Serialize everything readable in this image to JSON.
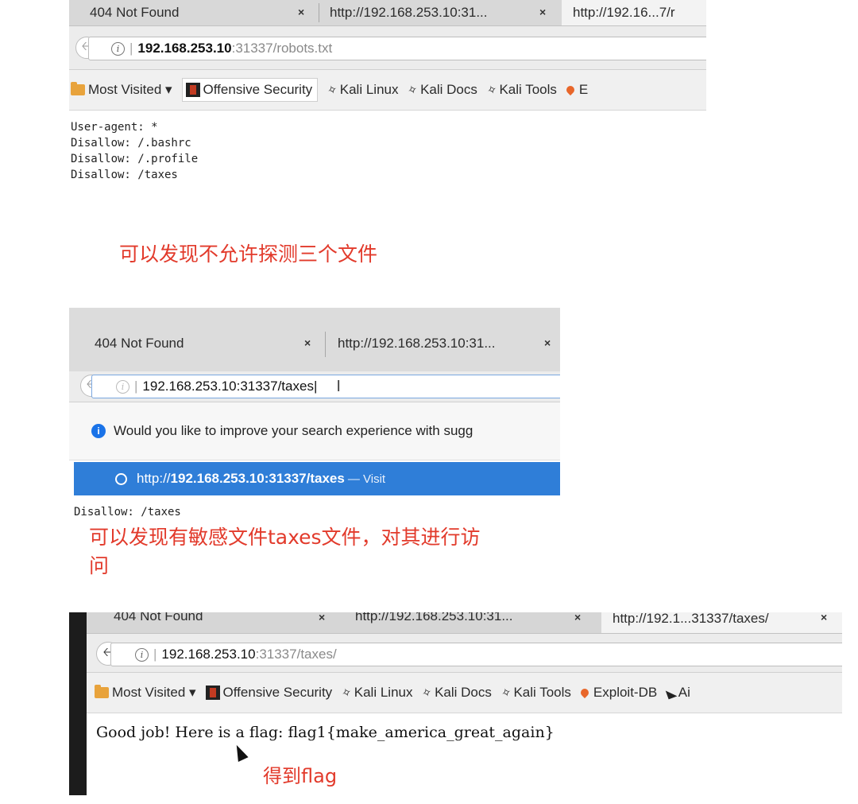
{
  "shot1": {
    "tabs": [
      {
        "label": "404 Not Found",
        "close": "×"
      },
      {
        "label": "http://192.168.253.10:31...",
        "close": "×"
      },
      {
        "label": "http://192.16...7/r"
      }
    ],
    "url_host": "192.168.253.10",
    "url_path": ":31337/robots.txt",
    "bookmarks": {
      "most_visited": "Most Visited ▾",
      "offensive_security": "Offensive Security",
      "kali_linux": "Kali Linux",
      "kali_docs": "Kali Docs",
      "kali_tools": "Kali Tools",
      "exploit_db": "E"
    },
    "robots_lines": [
      "User-agent: *",
      "Disallow: /.bashrc",
      "Disallow: /.profile",
      "Disallow: /taxes"
    ]
  },
  "annotation1": "可以发现不允许探测三个文件",
  "shot2": {
    "tabs": [
      {
        "label": "404 Not Found",
        "close": "×"
      },
      {
        "label": "http://192.168.253.10:31...",
        "close": "×"
      }
    ],
    "url_text": "192.168.253.10:31337/taxes",
    "suggestion_text": "Would you like to improve your search experience with sugg",
    "dropdown_prefix": "http://",
    "dropdown_bold": "192.168.253.10:31337/taxes",
    "dropdown_suffix": " — Visit",
    "page_line": "Disallow: /taxes"
  },
  "annotation2_line1": "可以发现有敏感文件taxes文件，对其进行访",
  "annotation2_line2": "问",
  "shot3": {
    "tabs": [
      {
        "label": "404 Not Found",
        "close": "×"
      },
      {
        "label": "http://192.168.253.10:31...",
        "close": "×"
      },
      {
        "label": "http://192.1...31337/taxes/",
        "close": "×"
      }
    ],
    "url_host": "192.168.253.10",
    "url_path": ":31337/taxes/",
    "bookmarks": {
      "most_visited": "Most Visited ▾",
      "offensive_security": "Offensive Security",
      "kali_linux": "Kali Linux",
      "kali_docs": "Kali Docs",
      "kali_tools": "Kali Tools",
      "exploit_db": "Exploit-DB",
      "ai": "Ai"
    },
    "page_text": "Good job! Here is a flag: flag1{make_america_great_again}"
  },
  "annotation3": "得到flag",
  "colors": {
    "annotation_red": "#e23a2b",
    "dropdown_blue": "#2f7ed8",
    "info_blue": "#1a73e8"
  }
}
